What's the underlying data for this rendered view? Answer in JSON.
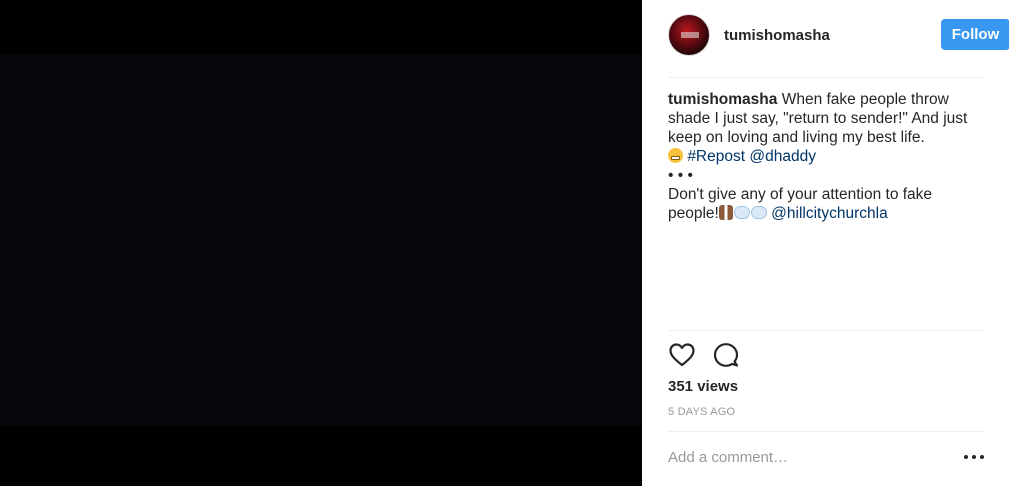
{
  "post": {
    "username": "tumishomasha",
    "follow_label": "Follow",
    "caption": {
      "username": "tumishomasha",
      "text_1": " When fake people throw shade I just say, \"return to sender!\" And just keep on loving and living my best life.",
      "hashtag_repost": "#Repost",
      "mention_1": "@dhaddy",
      "dots": "• • •",
      "text_2": "Don't give any of your attention to fake people!",
      "mention_2": "@hillcitychurchla"
    },
    "views": "351 views",
    "time": "5 DAYS AGO",
    "comment_placeholder": "Add a comment…"
  },
  "icons": {
    "like": "heart-icon",
    "comment": "comment-icon",
    "more": "more-options-icon"
  },
  "colors": {
    "follow_button": "#3897f0",
    "link": "#003569",
    "text": "#262626",
    "muted": "#999999"
  }
}
